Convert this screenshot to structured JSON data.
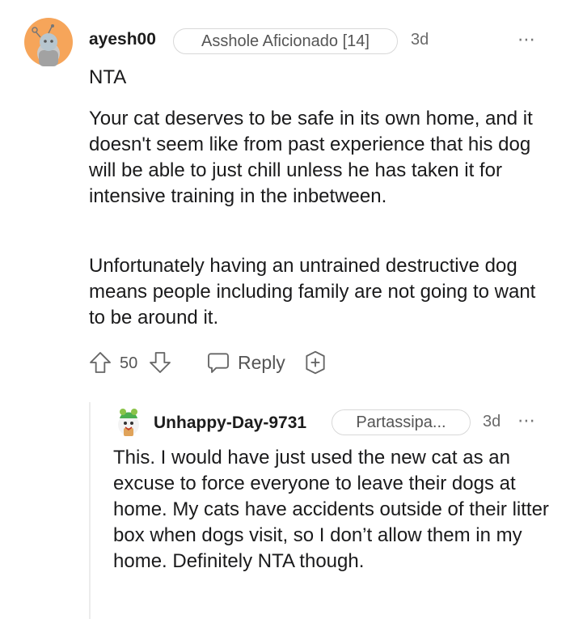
{
  "comment": {
    "author": "ayesh00",
    "flair": "Asshole Aficionado [14]",
    "age": "3d",
    "more_icon": "⋯",
    "verdict": "NTA",
    "paragraphs": [
      "Your cat deserves to be safe in its own home, and it doesn't seem like from past experience that his dog will be able to just chill unless he has taken it for intensive training in the inbetween.",
      "Unfortunately having an untrained destructive dog means people including family are not going to want to be around it."
    ],
    "score": "50",
    "reply_label": "Reply",
    "icons": [
      "upvote-icon",
      "downvote-icon",
      "reply-bubble-icon",
      "award-plus-icon"
    ]
  },
  "reply": {
    "author": "Unhappy-Day-9731",
    "flair": "Partassipa...",
    "age": "3d",
    "more_icon": "⋯",
    "body": "This. I would have just used the new cat as an excuse to force everyone to leave their dogs at home. My cats have accidents outside of their litter box when dogs visit, so I don’t allow them in my home. Definitely NTA though."
  },
  "colors": {
    "avatar_bg": "#f6a55a",
    "avatar_face": "#b7c6cf"
  }
}
